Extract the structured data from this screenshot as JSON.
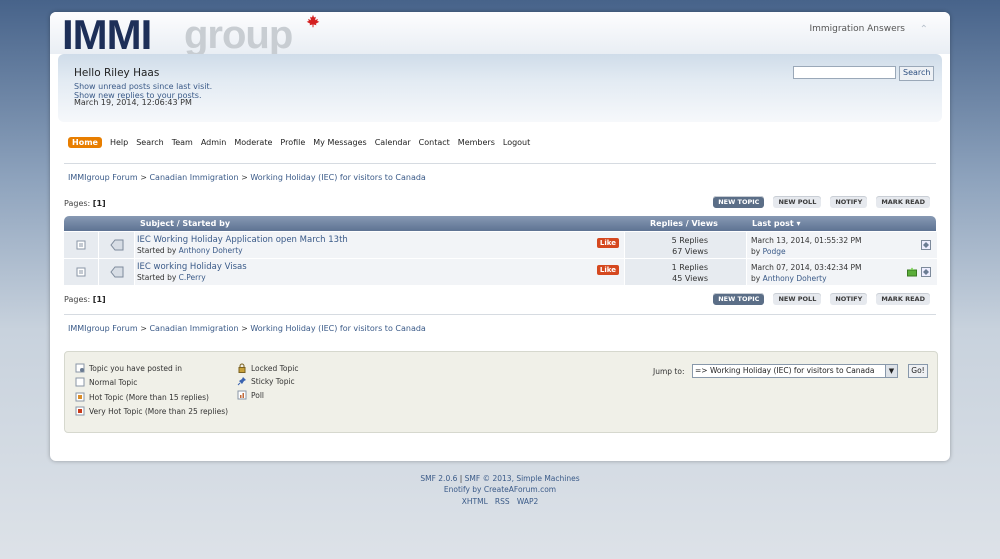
{
  "header": {
    "logo_main": "IMMI",
    "logo_sub": "group",
    "forum_title": "Immigration Answers"
  },
  "user": {
    "greeting": "Hello Riley Haas",
    "unread_link": "Show unread posts since last visit.",
    "replies_link": "Show new replies to your posts.",
    "datetime": "March 19, 2014, 12:06:43 PM"
  },
  "search": {
    "placeholder": "",
    "button_label": "Search"
  },
  "menu": {
    "items": [
      {
        "label": "Home",
        "active": true
      },
      {
        "label": "Help"
      },
      {
        "label": "Search"
      },
      {
        "label": "Team"
      },
      {
        "label": "Admin"
      },
      {
        "label": "Moderate"
      },
      {
        "label": "Profile"
      },
      {
        "label": "My Messages"
      },
      {
        "label": "Calendar"
      },
      {
        "label": "Contact"
      },
      {
        "label": "Members"
      },
      {
        "label": "Logout"
      }
    ]
  },
  "breadcrumb": {
    "items": [
      "IMMIgroup Forum",
      "Canadian Immigration",
      "Working Holiday (IEC) for visitors to Canada"
    ],
    "separator": ">"
  },
  "pagination": {
    "label": "Pages:",
    "current": "[1]"
  },
  "buttons": {
    "new_topic": "NEW TOPIC",
    "new_poll": "NEW POLL",
    "notify": "NOTIFY",
    "mark_read": "MARK READ"
  },
  "table": {
    "col_subject": "Subject / Started by",
    "col_replies": "Replies / Views",
    "col_lastpost": "Last post",
    "rows": [
      {
        "title": "IEC Working Holiday Application open March 13th",
        "started_prefix": "Started by",
        "author": "Anthony Doherty",
        "like": "Like",
        "replies": "5 Replies",
        "views": "67 Views",
        "last_date": "March 13, 2014, 01:55:32 PM",
        "by_prefix": "by",
        "last_by": "Podge"
      },
      {
        "title": "IEC working Holiday Visas",
        "started_prefix": "Started by",
        "author": "C.Perry",
        "like": "Like",
        "replies": "1 Replies",
        "views": "45 Views",
        "last_date": "March 07, 2014, 03:42:34 PM",
        "by_prefix": "by",
        "last_by": "Anthony Doherty"
      }
    ]
  },
  "legend": {
    "posted_in": "Topic you have posted in",
    "normal": "Normal Topic",
    "hot": "Hot Topic (More than 15 replies)",
    "very_hot": "Very Hot Topic (More than 25 replies)",
    "locked": "Locked Topic",
    "sticky": "Sticky Topic",
    "poll": "Poll"
  },
  "jump": {
    "label": "Jump to:",
    "selected": "=> Working Holiday (IEC) for visitors to Canada",
    "go": "Go!"
  },
  "footer": {
    "smf": "SMF 2.0.6",
    "copyright": "SMF © 2013, Simple Machines",
    "enotify": "Enotify by CreateAForum.com",
    "xhtml": "XHTML",
    "rss": "RSS",
    "wap2": "WAP2"
  },
  "colors": {
    "accent": "#e87e00",
    "link": "#3a5a88",
    "header_bar": "#5e7393",
    "like_badge": "#d5481f"
  }
}
